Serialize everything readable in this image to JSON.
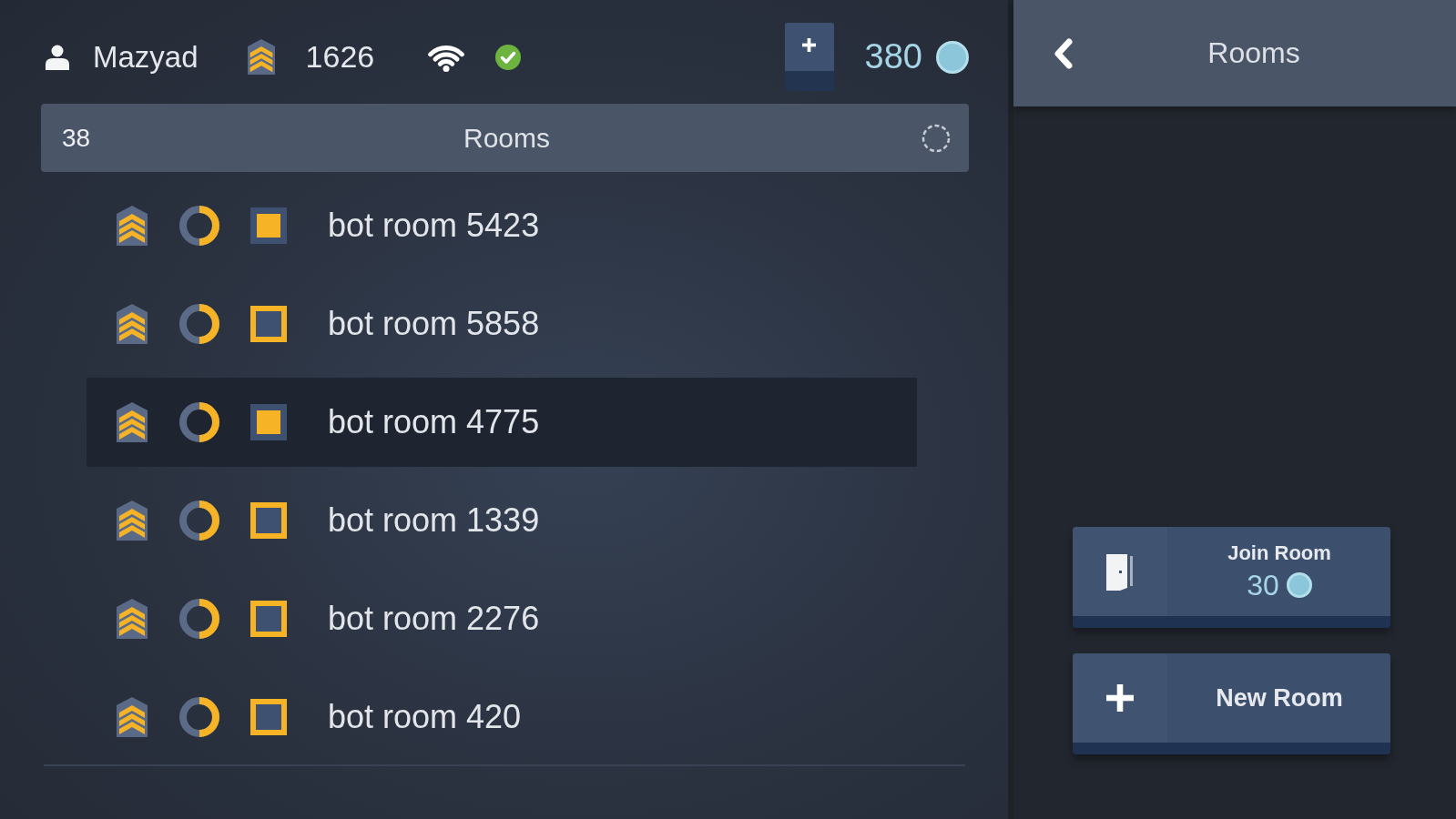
{
  "top_bar": {
    "username": "Mazyad",
    "rank_points": "1626",
    "connected": true,
    "coins": "380"
  },
  "room_list": {
    "count": "38",
    "title": "Rooms",
    "rooms": [
      {
        "name": "bot room 5423",
        "level": 0.5,
        "marked": true,
        "selected": false
      },
      {
        "name": "bot room 5858",
        "level": 0.5,
        "marked": false,
        "selected": false
      },
      {
        "name": "bot room 4775",
        "level": 0.5,
        "marked": true,
        "selected": true
      },
      {
        "name": "bot room 1339",
        "level": 0.5,
        "marked": false,
        "selected": false
      },
      {
        "name": "bot room 2276",
        "level": 0.5,
        "marked": false,
        "selected": false
      },
      {
        "name": "bot room 420",
        "level": 0.5,
        "marked": false,
        "selected": false
      }
    ]
  },
  "side_panel": {
    "title": "Rooms",
    "actions": [
      {
        "kind": "join",
        "label": "Join Room",
        "cost": "30"
      },
      {
        "kind": "new",
        "label": "New Room"
      }
    ]
  }
}
